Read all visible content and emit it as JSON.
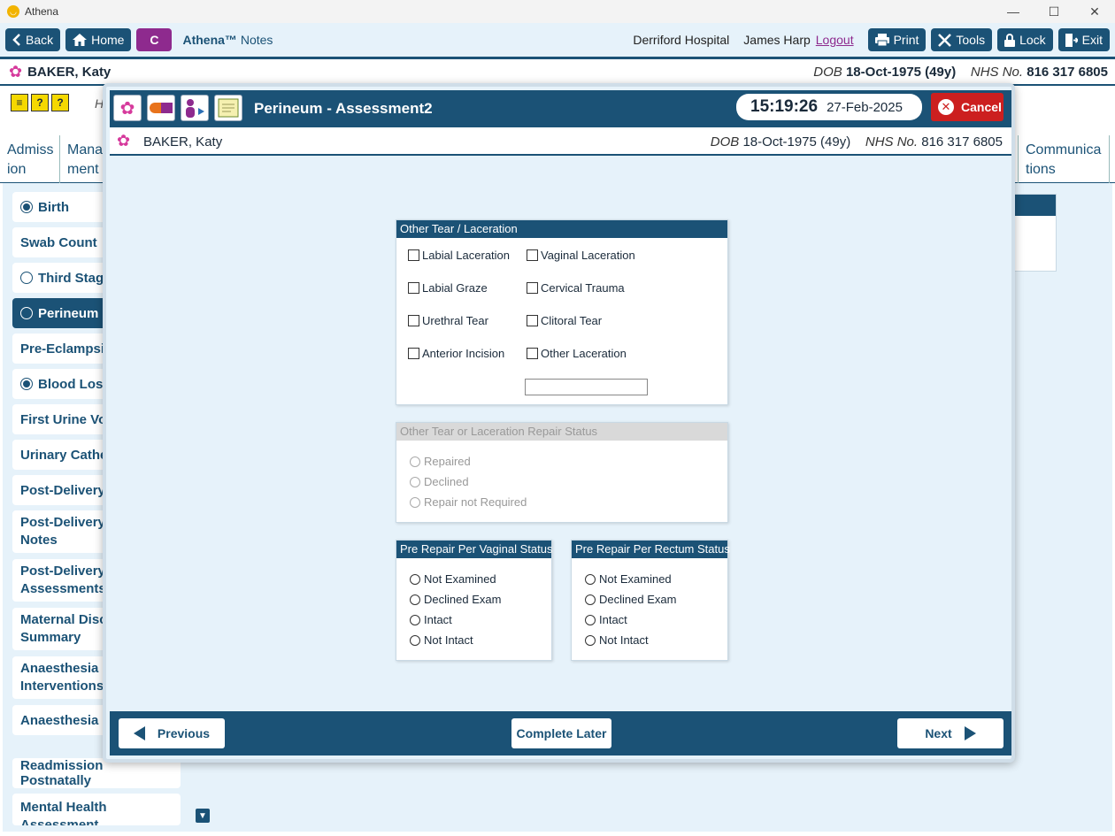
{
  "window": {
    "title": "Athena",
    "controls": [
      "—",
      "☐",
      "✕"
    ]
  },
  "toolbar": {
    "back": "Back",
    "home": "Home",
    "c_label": "C",
    "brand_name": "Athena™",
    "brand_suffix": "Notes",
    "hospital": "Derriford Hospital",
    "user": "James Harp",
    "logout": "Logout",
    "print": "Print",
    "tools": "Tools",
    "lock": "Lock",
    "exit": "Exit"
  },
  "patient": {
    "name": "BAKER, Katy",
    "dob_label": "DOB",
    "dob": "18-Oct-1975 (49y)",
    "nhs_label": "NHS No.",
    "nhs": "816 317 6805"
  },
  "background": {
    "header_fragment": "H",
    "tabs": [
      {
        "label": "Admiss ion"
      },
      {
        "label": "Mana ment"
      },
      {
        "label": "Communica tions"
      }
    ],
    "sidebar": [
      {
        "label": "Birth",
        "radio": "filled"
      },
      {
        "label": "Swab Count",
        "radio": "none"
      },
      {
        "label": "Third Stage",
        "radio": "empty"
      },
      {
        "label": "Perineum",
        "radio": "empty",
        "active": true
      },
      {
        "label": "Pre-Eclampsia",
        "radio": "none"
      },
      {
        "label": "Blood Loss",
        "radio": "filled"
      },
      {
        "label": "First Urine Voi",
        "radio": "none"
      },
      {
        "label": "Urinary Cathe",
        "radio": "none"
      },
      {
        "label": "Post-Delivery",
        "radio": "none"
      },
      {
        "label": "Post-Delivery Notes",
        "radio": "none"
      },
      {
        "label": "Post-Delivery Assessments",
        "radio": "none"
      },
      {
        "label": "Maternal Disc Summary",
        "radio": "none"
      },
      {
        "label": "Anaesthesia Interventions",
        "radio": "none"
      },
      {
        "label": "Anaesthesia F",
        "radio": "none"
      },
      {
        "label": "Readmission Postnatally",
        "radio": "none"
      },
      {
        "label": "Mental Health Assessment",
        "radio": "none"
      }
    ]
  },
  "modal": {
    "title": "Perineum - Assessment2",
    "time": "15:19:26",
    "date": "27-Feb-2025",
    "cancel": "Cancel",
    "other_tear": {
      "heading": "Other Tear / Laceration",
      "options": [
        "Labial Laceration",
        "Vaginal Laceration",
        "Labial Graze",
        "Cervical Trauma",
        "Urethral Tear",
        "Clitoral Tear",
        "Anterior Incision",
        "Other Laceration"
      ],
      "other_text": ""
    },
    "repair_status": {
      "heading": "Other Tear or Laceration Repair Status",
      "options": [
        "Repaired",
        "Declined",
        "Repair not Required"
      ]
    },
    "vaginal_status": {
      "heading": "Pre Repair Per Vaginal Status",
      "options": [
        "Not Examined",
        "Declined Exam",
        "Intact",
        "Not Intact"
      ]
    },
    "rectum_status": {
      "heading": "Pre Repair Per Rectum Status",
      "options": [
        "Not Examined",
        "Declined Exam",
        "Intact",
        "Not Intact"
      ]
    },
    "footer": {
      "previous": "Previous",
      "complete_later": "Complete Later",
      "next": "Next"
    }
  },
  "colors": {
    "primary": "#1b5276",
    "accent_purple": "#8e2a8e",
    "cancel_red": "#cc1f1f",
    "panel_bg": "#e6f2fa"
  }
}
